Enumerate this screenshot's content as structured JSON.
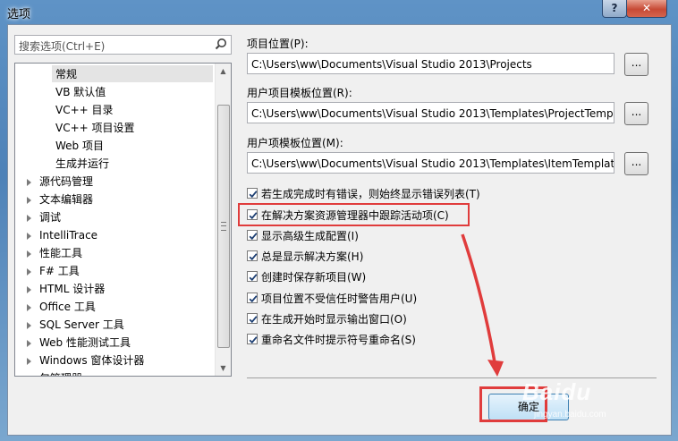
{
  "window": {
    "title": "选项",
    "help_label": "?",
    "close_label": "✕"
  },
  "search": {
    "placeholder": "搜索选项(Ctrl+E)"
  },
  "tree": {
    "items": [
      {
        "label": "常规",
        "level": 1,
        "selected": true
      },
      {
        "label": "VB 默认值",
        "level": 1
      },
      {
        "label": "VC++ 目录",
        "level": 1
      },
      {
        "label": "VC++ 项目设置",
        "level": 1
      },
      {
        "label": "Web 项目",
        "level": 1
      },
      {
        "label": "生成并运行",
        "level": 1
      },
      {
        "label": "源代码管理",
        "level": 0
      },
      {
        "label": "文本编辑器",
        "level": 0
      },
      {
        "label": "调试",
        "level": 0
      },
      {
        "label": "IntelliTrace",
        "level": 0
      },
      {
        "label": "性能工具",
        "level": 0
      },
      {
        "label": "F# 工具",
        "level": 0
      },
      {
        "label": "HTML 设计器",
        "level": 0
      },
      {
        "label": "Office 工具",
        "level": 0
      },
      {
        "label": "SQL Server 工具",
        "level": 0
      },
      {
        "label": "Web 性能测试工具",
        "level": 0
      },
      {
        "label": "Windows 窗体设计器",
        "level": 0
      },
      {
        "label": "包管理器",
        "level": 0
      }
    ]
  },
  "fields": {
    "projects": {
      "label": "项目位置(P):",
      "value": "C:\\Users\\ww\\Documents\\Visual Studio 2013\\Projects",
      "browse": "..."
    },
    "user_project_templates": {
      "label": "用户项目模板位置(R):",
      "value": "C:\\Users\\ww\\Documents\\Visual Studio 2013\\Templates\\ProjectTempla",
      "browse": "..."
    },
    "user_item_templates": {
      "label": "用户项模板位置(M):",
      "value": "C:\\Users\\ww\\Documents\\Visual Studio 2013\\Templates\\ItemTemplates",
      "browse": "..."
    }
  },
  "checkboxes": [
    {
      "label": "若生成完成时有错误，则始终显示错误列表(T)",
      "checked": true
    },
    {
      "label": "在解决方案资源管理器中跟踪活动项(C)",
      "checked": true
    },
    {
      "label": "显示高级生成配置(I)",
      "checked": true
    },
    {
      "label": "总是显示解决方案(H)",
      "checked": true
    },
    {
      "label": "创建时保存新项目(W)",
      "checked": true
    },
    {
      "label": "项目位置不受信任时警告用户(U)",
      "checked": true
    },
    {
      "label": "在生成开始时显示输出窗口(O)",
      "checked": true
    },
    {
      "label": "重命名文件时提示符号重命名(S)",
      "checked": true
    }
  ],
  "buttons": {
    "ok": "确定"
  },
  "watermark": {
    "brand": "Baidu",
    "sub": "jingyan.baidu.com"
  },
  "colors": {
    "annotation": "#e03c3c",
    "selection": "#e4e4e4"
  }
}
